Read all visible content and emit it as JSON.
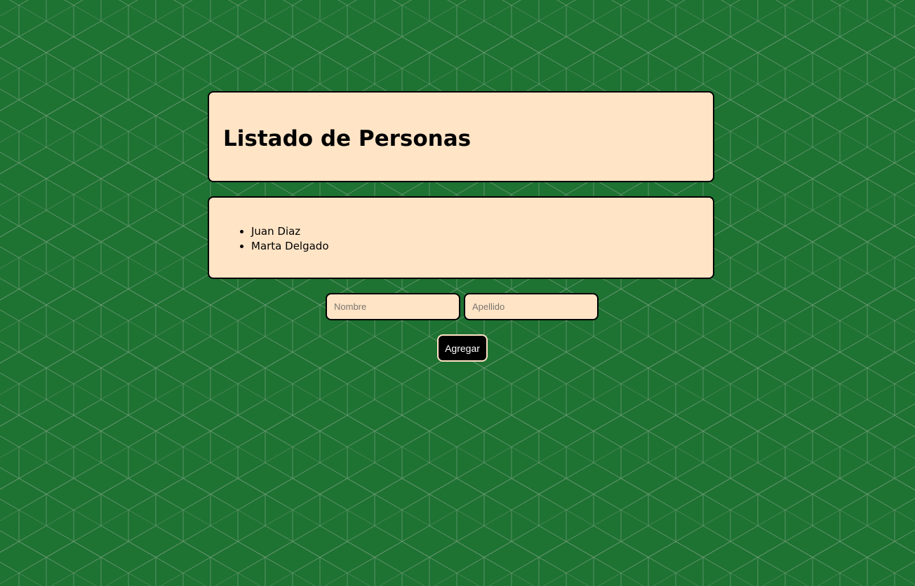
{
  "colors": {
    "background": "#1e7232",
    "pattern_line": "#6f9a77",
    "card": "#ffe4c6",
    "border": "#000000",
    "button": "#000000",
    "button_text": "#ffffff"
  },
  "header": {
    "title": "Listado de Personas"
  },
  "people": [
    "Juan Diaz",
    "Marta Delgado"
  ],
  "form": {
    "nombre": {
      "value": "",
      "placeholder": "Nombre"
    },
    "apellido": {
      "value": "",
      "placeholder": "Apellido"
    },
    "add_label": "Agregar"
  }
}
